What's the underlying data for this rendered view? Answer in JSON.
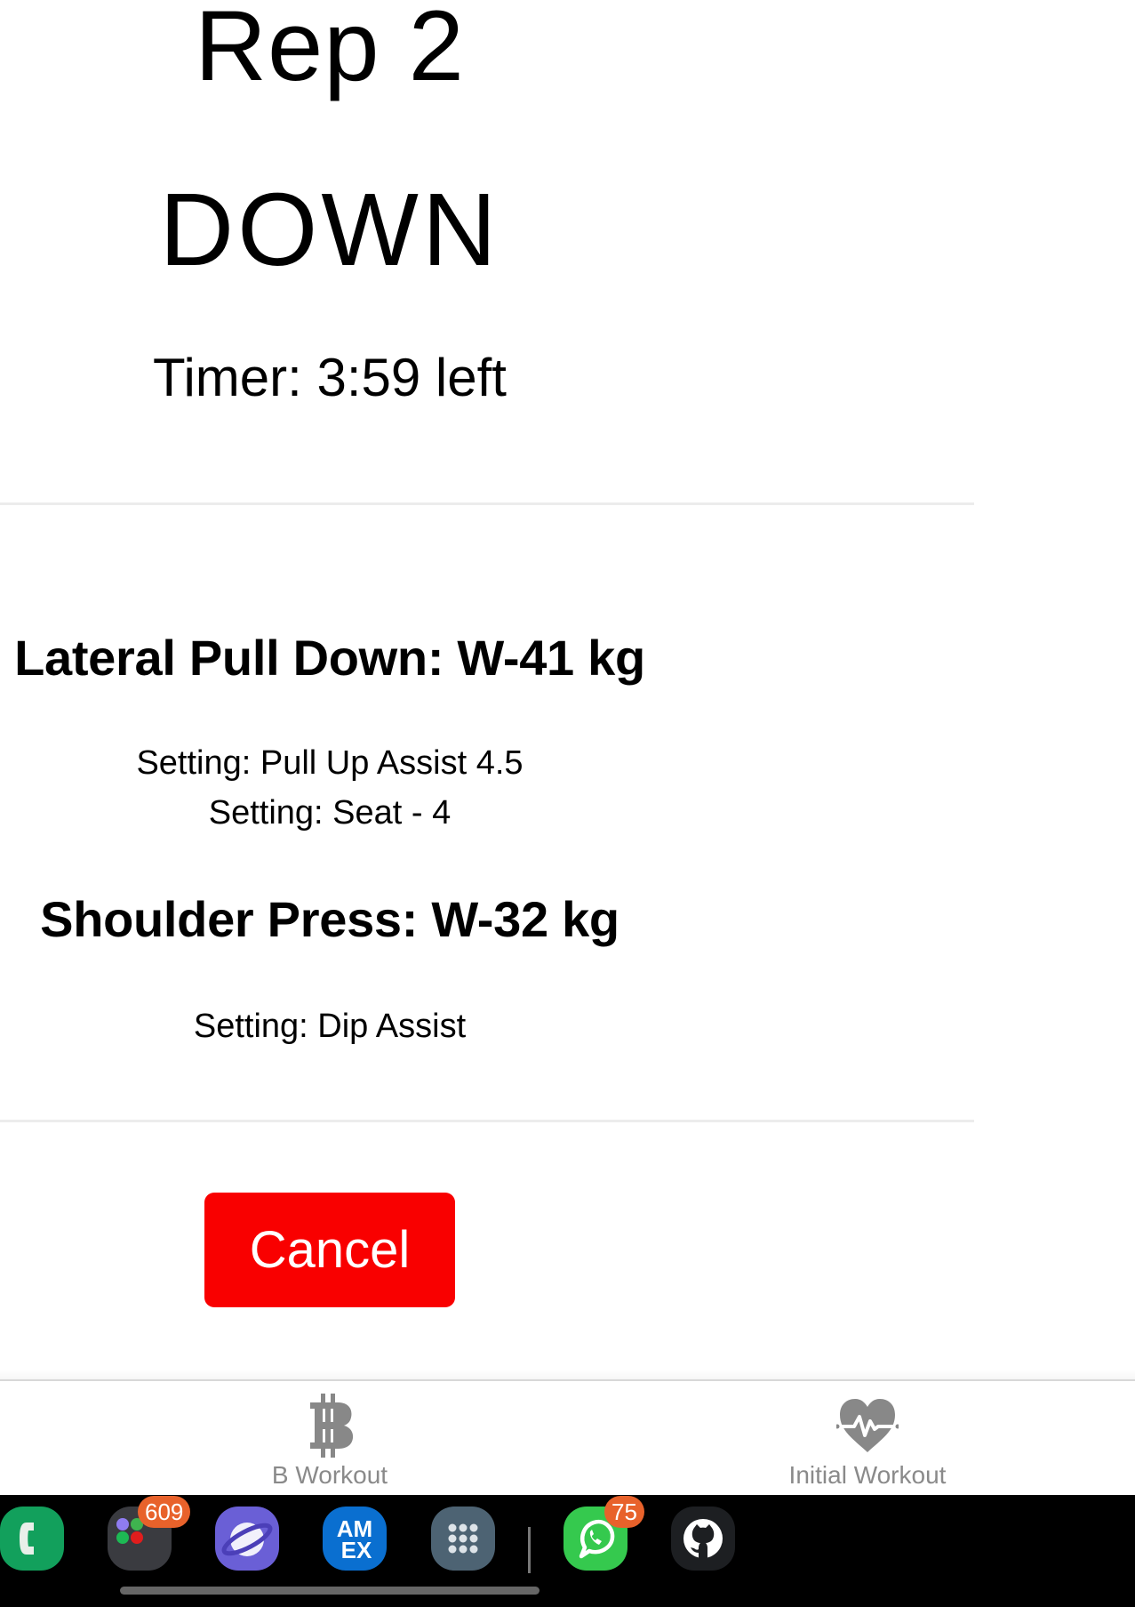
{
  "workout": {
    "rep_label": "Rep 2",
    "phase": "DOWN",
    "timer_text": "Timer: 3:59 left"
  },
  "exercises": [
    {
      "title": "Lateral Pull Down: W-41 kg",
      "settings": [
        "Setting: Pull Up Assist 4.5",
        "Setting: Seat - 4"
      ]
    },
    {
      "title": "Shoulder Press: W-32 kg",
      "settings": [
        "Setting: Dip Assist"
      ]
    }
  ],
  "actions": {
    "cancel_label": "Cancel",
    "cancel_color": "#f90000"
  },
  "tabbar": {
    "tabs": [
      {
        "label": "B Workout",
        "icon": "bitcoin-b-icon"
      },
      {
        "label": "Initial Workout",
        "icon": "heartbeat-icon"
      }
    ],
    "icon_color": "#888888"
  },
  "dock": {
    "apps": [
      {
        "name": "Phone",
        "icon": "phone-icon",
        "color": "#12a05c"
      },
      {
        "name": "Folder",
        "icon": "app-folder-icon",
        "color": "#3a3b40",
        "badge": "609"
      },
      {
        "name": "Samsung Internet",
        "icon": "planet-icon",
        "color": "#6a5fd6"
      },
      {
        "name": "Amex",
        "icon": "amex-icon",
        "color": "#0a6fd0"
      },
      {
        "name": "Apps",
        "icon": "app-grid-icon",
        "color": "#4d6373"
      },
      {
        "name": "WhatsApp",
        "icon": "whatsapp-icon",
        "color": "#35c94e",
        "badge": "75"
      },
      {
        "name": "GitHub",
        "icon": "github-icon",
        "color": "#1d1f22"
      }
    ]
  }
}
